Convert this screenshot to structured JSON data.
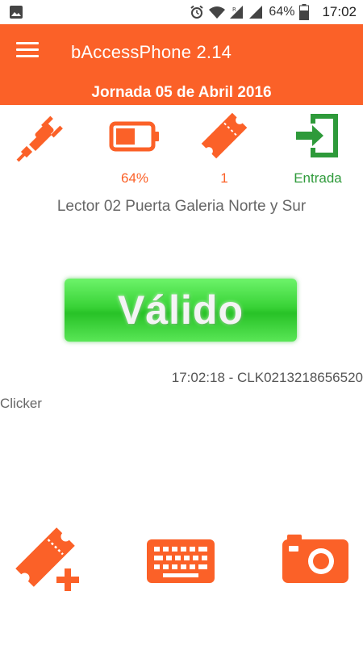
{
  "status_bar": {
    "battery": "64%",
    "time": "17:02",
    "icons": [
      "image-icon",
      "alarm-icon",
      "wifi-icon",
      "signal-icon",
      "battery-icon"
    ]
  },
  "app_bar": {
    "title": "bAccessPhone 2.14",
    "subtitle": "Jornada 05 de Abril 2016"
  },
  "indicators": [
    {
      "icon": "plug-icon",
      "value": ""
    },
    {
      "icon": "battery-icon",
      "value": "64%"
    },
    {
      "icon": "ticket-icon",
      "value": "1"
    },
    {
      "icon": "entrance-icon",
      "value": "Entrada"
    }
  ],
  "reader": "Lector 02 Puerta Galeria Norte y Sur",
  "result": "Válido",
  "scan_info": "17:02:18 - CLK0213218656520",
  "mode": "Clicker",
  "actions": [
    "add-ticket-icon",
    "keyboard-icon",
    "camera-icon"
  ],
  "colors": {
    "accent": "#fb6128",
    "success": "#2e9a3a",
    "valid_button": "#39d337"
  }
}
